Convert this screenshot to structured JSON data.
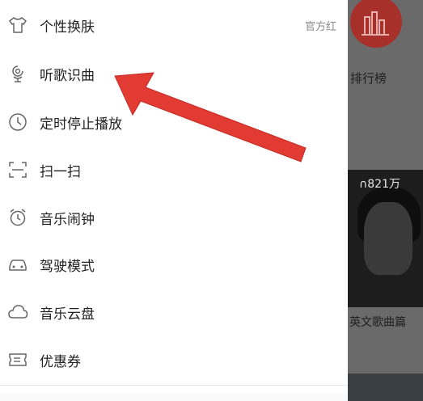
{
  "menu": {
    "items": [
      {
        "label": "个性换肤",
        "badge": "官方红",
        "icon": "shirt-icon"
      },
      {
        "label": "听歌识曲",
        "icon": "mic-recognize-icon"
      },
      {
        "label": "定时停止播放",
        "icon": "clock-icon"
      },
      {
        "label": "扫一扫",
        "icon": "scan-icon"
      },
      {
        "label": "音乐闹钟",
        "icon": "alarm-clock-icon"
      },
      {
        "label": "驾驶模式",
        "icon": "car-icon"
      },
      {
        "label": "音乐云盘",
        "icon": "cloud-icon"
      },
      {
        "label": "优惠券",
        "icon": "coupon-icon"
      }
    ]
  },
  "background_app": {
    "rank_label": "排行榜",
    "play_count": "821万",
    "playlist_caption": "英文歌曲篇"
  },
  "colors": {
    "accent": "#d8352e",
    "arrow": "#e13b33",
    "dim_overlay": "#5b5b5b",
    "icon": "#666666"
  }
}
